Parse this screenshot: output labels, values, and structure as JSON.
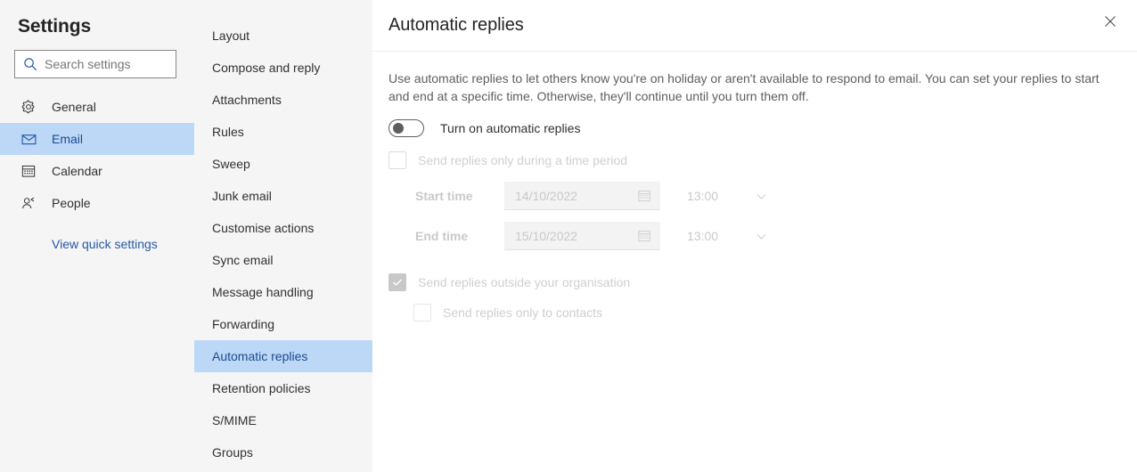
{
  "sidebar": {
    "title": "Settings",
    "search": {
      "placeholder": "Search settings",
      "value": "",
      "icon": "search-icon",
      "icon_color": "#2558a6"
    },
    "items": [
      {
        "label": "General",
        "icon": "gear-icon",
        "active": false
      },
      {
        "label": "Email",
        "icon": "envelope-icon",
        "active": true
      },
      {
        "label": "Calendar",
        "icon": "calendar-icon",
        "active": false
      },
      {
        "label": "People",
        "icon": "person-icon",
        "active": false
      }
    ],
    "quick_link": "View quick settings"
  },
  "midcol": {
    "items": [
      {
        "label": "Layout",
        "active": false
      },
      {
        "label": "Compose and reply",
        "active": false
      },
      {
        "label": "Attachments",
        "active": false
      },
      {
        "label": "Rules",
        "active": false
      },
      {
        "label": "Sweep",
        "active": false
      },
      {
        "label": "Junk email",
        "active": false
      },
      {
        "label": "Customise actions",
        "active": false
      },
      {
        "label": "Sync email",
        "active": false
      },
      {
        "label": "Message handling",
        "active": false
      },
      {
        "label": "Forwarding",
        "active": false
      },
      {
        "label": "Automatic replies",
        "active": true
      },
      {
        "label": "Retention policies",
        "active": false
      },
      {
        "label": "S/MIME",
        "active": false
      },
      {
        "label": "Groups",
        "active": false
      }
    ]
  },
  "main": {
    "title": "Automatic replies",
    "close_label": "✕",
    "description": "Use automatic replies to let others know you're on holiday or aren't available to respond to email. You can set your replies to start and end at a specific time. Otherwise, they'll continue until you turn them off.",
    "toggle": {
      "label": "Turn on automatic replies",
      "state": "off"
    },
    "time_period": {
      "checkbox_label": "Send replies only during a time period",
      "checked": false,
      "start": {
        "label": "Start time",
        "date": "14/10/2022",
        "time": "13:00"
      },
      "end": {
        "label": "End time",
        "date": "15/10/2022",
        "time": "13:00"
      }
    },
    "outside_org": {
      "label": "Send replies outside your organisation",
      "checked": true,
      "sub": {
        "label": "Send replies only to contacts",
        "checked": false
      }
    }
  },
  "colors": {
    "selection_blue": "#bdd8f7",
    "link_blue": "#2558a6",
    "panel_grey": "#f5f5f5",
    "text_primary": "#323130",
    "text_secondary": "#605e5c",
    "disabled_text": "#c9c9c9"
  }
}
